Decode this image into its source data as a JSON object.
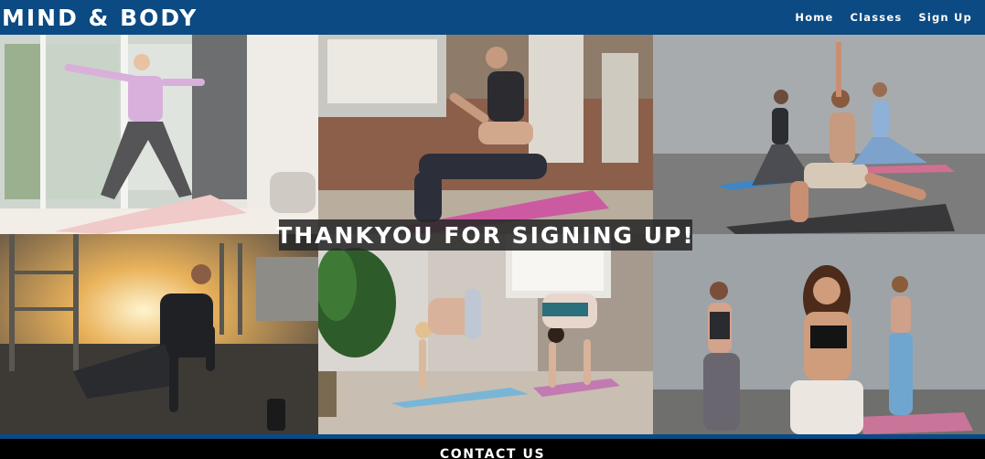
{
  "header": {
    "brand": "MIND & BODY",
    "nav": [
      {
        "label": "Home"
      },
      {
        "label": "Classes"
      },
      {
        "label": "Sign Up"
      }
    ]
  },
  "gallery": {
    "images": [
      {
        "subject": "woman in warrior pose by window"
      },
      {
        "subject": "woman stretching on pink mat"
      },
      {
        "subject": "group in lunge pose"
      },
      {
        "subject": "man stretching outdoors at sunset"
      },
      {
        "subject": "two women in crow pose"
      },
      {
        "subject": "three women meditating"
      }
    ]
  },
  "message": "THANKYOU FOR SIGNING UP!",
  "footer": {
    "heading": "CONTACT US"
  },
  "colors": {
    "header_bg": "#0b4a82",
    "overlay_bg": "#282828",
    "footer_bg": "#000000"
  }
}
